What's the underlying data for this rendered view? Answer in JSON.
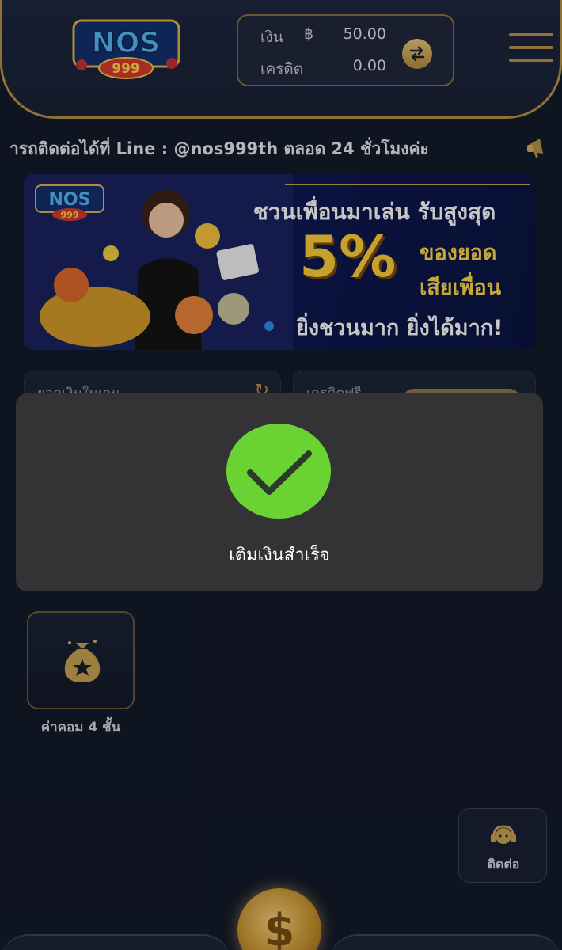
{
  "header": {
    "logo_text": "NOS999",
    "balance": {
      "label": "เงิน",
      "currency": "฿",
      "value": "50.00"
    },
    "credit": {
      "label": "เครดิต",
      "value": "0.00"
    }
  },
  "marquee": {
    "text": "ารถติดต่อได้ที่ Line : @nos999th ตลอด 24 ชั่วโมงค่ะ"
  },
  "banner": {
    "line1": "ชวนเพื่อนมาเล่น รับสูงสุด",
    "percent": "5%",
    "line2a": "ของยอด",
    "line2b": "เสียเพื่อน",
    "line3": "ยิ่งชวนมาก ยิ่งได้มาก!"
  },
  "cards": {
    "left_label": "ยอดเงินในเกม",
    "right_label": "เครดิตฟรี"
  },
  "toast": {
    "message": "เติมเงินสำเร็จ"
  },
  "quick_items": [
    {
      "label": "ค่าคอม 4 ชั้น",
      "icon": "money-bag-star-icon"
    }
  ],
  "contact": {
    "label": "ติดต่อ",
    "icon": "headset-icon"
  },
  "colors": {
    "gold": "#b8934a",
    "background": "#141a2b",
    "success": "#6bd234"
  }
}
